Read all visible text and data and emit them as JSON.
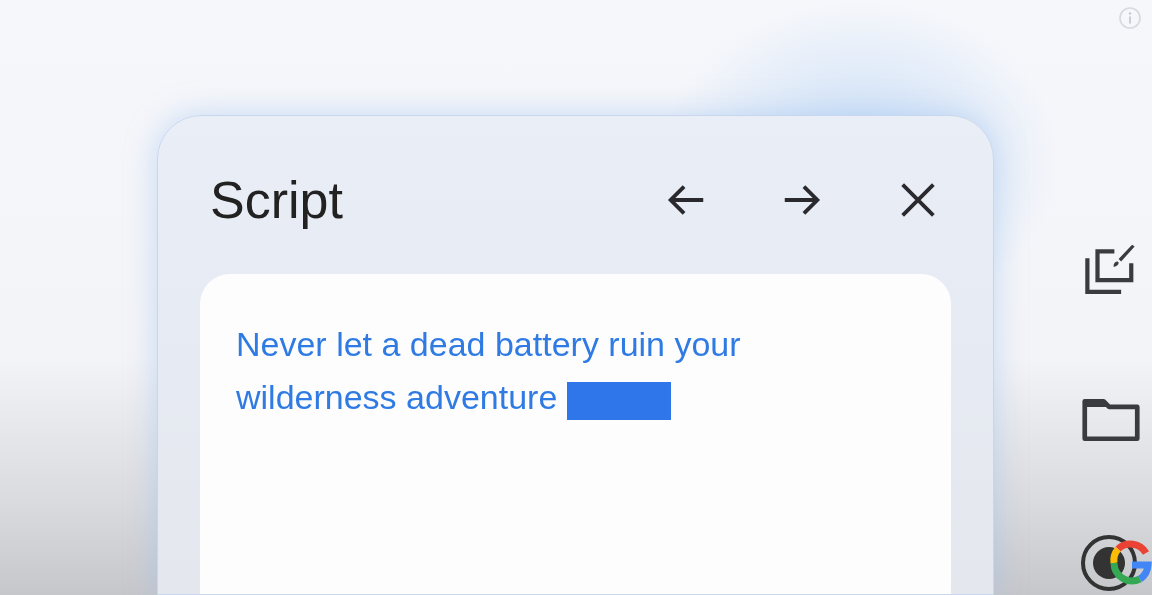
{
  "panel": {
    "title": "Script",
    "lines": [
      "Never let a dead battery ruin your",
      "wilderness adventure"
    ]
  }
}
